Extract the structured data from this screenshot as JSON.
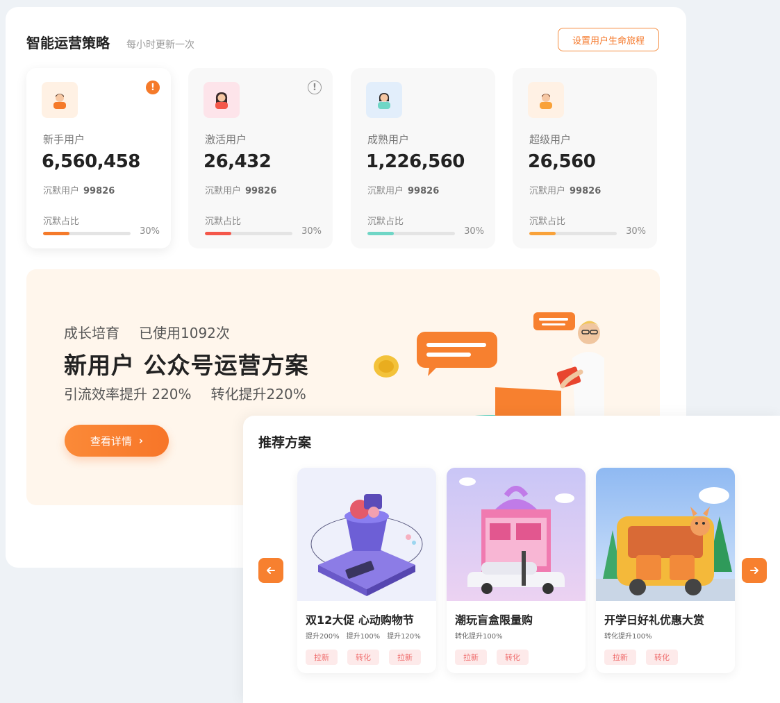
{
  "header": {
    "title": "智能运营策略",
    "subtitle": "每小时更新一次",
    "lifecycle_button": "设置用户生命旅程"
  },
  "cards": [
    {
      "label": "新手用户",
      "value": "6,560,458",
      "silent_label": "沉默用户",
      "silent_value": "99826",
      "ratio_label": "沉默占比",
      "pct": "30%",
      "fill": 0.3,
      "color": "#f57a2a",
      "avatar_bg": "#fff1e4",
      "icon": "user-male-icon",
      "alert": "filled"
    },
    {
      "label": "激活用户",
      "value": "26,432",
      "silent_label": "沉默用户",
      "silent_value": "99826",
      "ratio_label": "沉默占比",
      "pct": "30%",
      "fill": 0.3,
      "color": "#f4574a",
      "avatar_bg": "#fde4ea",
      "icon": "user-female-icon",
      "alert": "outline"
    },
    {
      "label": "成熟用户",
      "value": "1,226,560",
      "silent_label": "沉默用户",
      "silent_value": "99826",
      "ratio_label": "沉默占比",
      "pct": "30%",
      "fill": 0.3,
      "color": "#6fd6c6",
      "avatar_bg": "#e2eefb",
      "icon": "user-female-icon",
      "alert": "none"
    },
    {
      "label": "超级用户",
      "value": "26,560",
      "silent_label": "沉默用户",
      "silent_value": "99826",
      "ratio_label": "沉默占比",
      "pct": "30%",
      "fill": 0.3,
      "color": "#f9a23a",
      "avatar_bg": "#fff1e4",
      "icon": "user-male-icon",
      "alert": "none"
    }
  ],
  "banner": {
    "category": "成长培育",
    "usage": "已使用1092次",
    "title": "新用户  公众号运营方案",
    "metric1": "引流效率提升 220%",
    "metric2": "转化提升220%",
    "button": "查看详情"
  },
  "recommend": {
    "title": "推荐方案",
    "items": [
      {
        "title": "双12大促 心动购物节",
        "metrics": [
          "提升200%",
          "提升100%",
          "提升120%"
        ],
        "tags": [
          "拉新",
          "转化",
          "拉新"
        ]
      },
      {
        "title": "潮玩盲盒限量购",
        "metrics": [
          "转化提升100%"
        ],
        "tags": [
          "拉新",
          "转化"
        ]
      },
      {
        "title": "开学日好礼优惠大赏",
        "metrics": [
          "转化提升100%"
        ],
        "tags": [
          "拉新",
          "转化"
        ]
      }
    ]
  },
  "colors": {
    "accent": "#f7802f",
    "tag_bg": "#fdeaea",
    "tag_text": "#ef6b6b"
  }
}
